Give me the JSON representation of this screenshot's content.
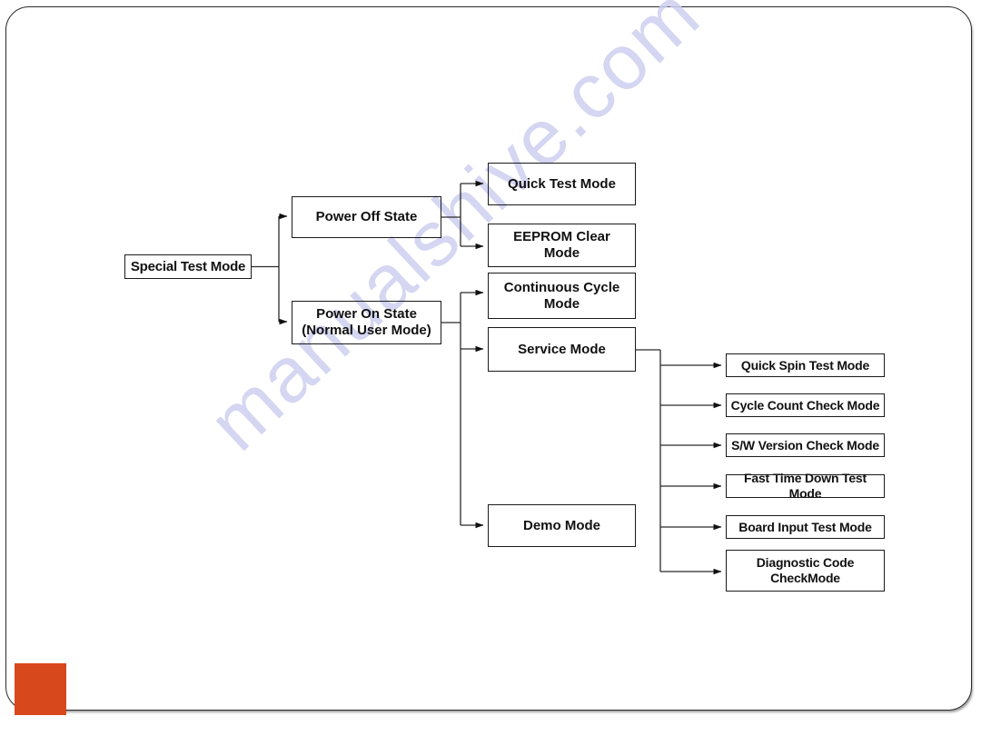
{
  "page": {
    "background_color": "#ffffff",
    "frame_border_color": "#2b2b2b",
    "accent_color": "#d8481d",
    "watermark_text": "manualshive.com",
    "watermark_color": "#cdd0f0"
  },
  "diagram": {
    "type": "tree",
    "title": "",
    "root": {
      "id": "special-test-mode",
      "label": "Special Test Mode"
    },
    "level1": [
      {
        "id": "power-off-state",
        "label": "Power Off State"
      },
      {
        "id": "power-on-state",
        "label": "Power On State\n(Normal User Mode)",
        "line1": "Power On State",
        "line2": "(Normal User Mode)"
      }
    ],
    "level2": [
      {
        "id": "quick-test-mode",
        "label": "Quick Test Mode",
        "parent": "power-off-state"
      },
      {
        "id": "eeprom-clear-mode",
        "label": "EEPROM Clear Mode",
        "line1": "EEPROM Clear",
        "line2": "Mode",
        "parent": "power-off-state"
      },
      {
        "id": "continuous-cycle-mode",
        "label": "Continuous Cycle Mode",
        "line1": "Continuous Cycle",
        "line2": "Mode",
        "parent": "power-on-state"
      },
      {
        "id": "service-mode",
        "label": "Service Mode",
        "parent": "power-on-state"
      },
      {
        "id": "demo-mode",
        "label": "Demo Mode",
        "parent": "power-on-state"
      }
    ],
    "level3": [
      {
        "id": "quick-spin-test-mode",
        "label": "Quick Spin Test Mode",
        "parent": "service-mode"
      },
      {
        "id": "cycle-count-check-mode",
        "label": "Cycle Count Check Mode",
        "parent": "service-mode"
      },
      {
        "id": "sw-version-check-mode",
        "label": "S/W Version Check Mode",
        "parent": "service-mode"
      },
      {
        "id": "fast-time-down-test-mode",
        "label": "Fast Time Down Test Mode",
        "parent": "service-mode"
      },
      {
        "id": "board-input-test-mode",
        "label": "Board Input Test Mode",
        "parent": "service-mode"
      },
      {
        "id": "diagnostic-code-check-mode",
        "label": "Diagnostic Code CheckMode",
        "line1": "Diagnostic Code",
        "line2": "CheckMode",
        "parent": "service-mode"
      }
    ]
  }
}
